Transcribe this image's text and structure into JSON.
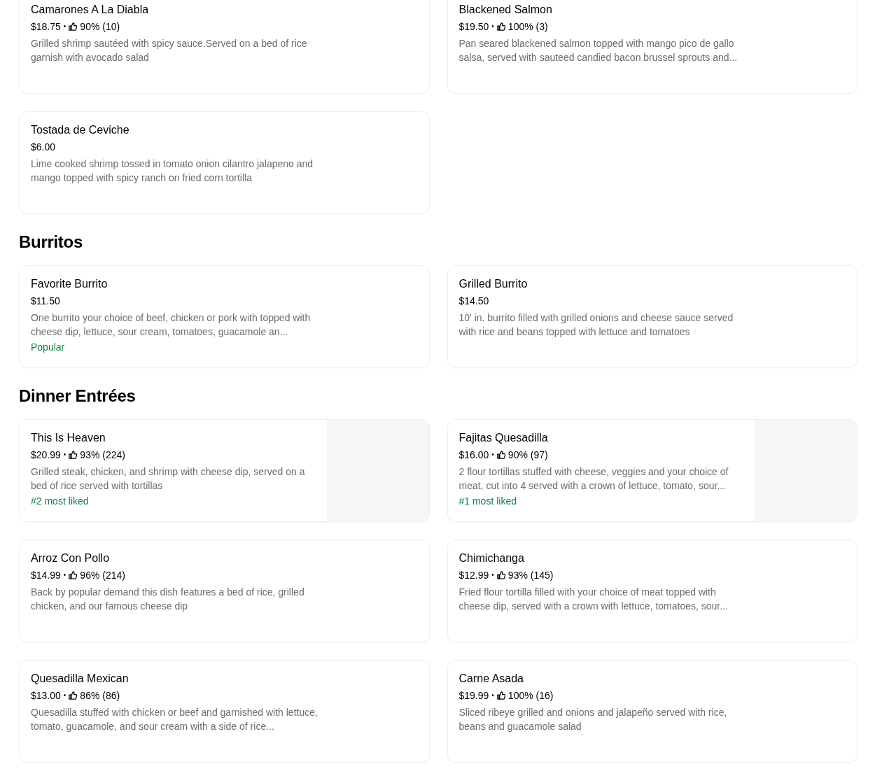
{
  "sections": [
    {
      "items": [
        {
          "kind": "plain",
          "name": "Camarones A La Diabla",
          "price": "$18.75",
          "separator": "•",
          "rating": "90% (10)",
          "description": "Grilled shrimp sautéed with spicy sauce.Served on a bed of rice garnish with avocado salad"
        },
        {
          "kind": "plain",
          "name": "Blackened Salmon",
          "price": "$19.50",
          "separator": "•",
          "rating": "100% (3)",
          "description": "Pan seared blackened salmon topped with mango pico de gallo salsa, served with sauteed candied bacon brussel sprouts and..."
        },
        {
          "kind": "plain",
          "name": "Tostada de Ceviche",
          "price": "$6.00",
          "description": "Lime cooked shrimp tossed in tomato onion cilantro jalapeno and mango topped with spicy ranch on fried corn tortilla"
        }
      ]
    },
    {
      "title": "Burritos",
      "items": [
        {
          "kind": "plain",
          "name": "Favorite Burrito",
          "price": "$11.50",
          "description": "One burrito your choice of beef, chicken or pork with topped with cheese dip, lettuce, sour cream, tomatoes, guacamole an...",
          "badge": "Popular"
        },
        {
          "kind": "plain",
          "name": "Grilled Burrito",
          "price": "$14.50",
          "description": "10' in. burrito filled with grilled onions and cheese sauce served with rice and beans topped with lettuce and tomatoes"
        }
      ]
    },
    {
      "title": "Dinner Entrées",
      "items": [
        {
          "kind": "with-image",
          "name": "This Is Heaven",
          "price": "$20.99",
          "separator": "•",
          "rating": "93% (224)",
          "description": "Grilled steak, chicken, and shrimp with cheese dip, served on a bed of rice served with tortillas",
          "badge": "#2 most liked"
        },
        {
          "kind": "with-image",
          "name": "Fajitas Quesadilla",
          "price": "$16.00",
          "separator": "•",
          "rating": "90% (97)",
          "description": "2 flour tortillas stuffed with cheese, veggies and your choice of meat, cut into 4 served with a crown of lettuce, tomato, sour...",
          "badge": "#1 most liked"
        },
        {
          "kind": "plain",
          "name": "Arroz Con Pollo",
          "price": "$14.99",
          "separator": "•",
          "rating": "96% (214)",
          "description": "Back by popular demand this dish features a bed of rice, grilled chicken, and our famous cheese dip"
        },
        {
          "kind": "plain",
          "name": "Chimichanga",
          "price": "$12.99",
          "separator": "•",
          "rating": "93% (145)",
          "description": "Fried flour tortilla filled with your choice of meat topped with cheese dip, served with a crown with lettuce, tomatoes, sour..."
        },
        {
          "kind": "plain",
          "name": "Quesadilla Mexican",
          "price": "$13.00",
          "separator": "•",
          "rating": "86% (86)",
          "description": "Quesadilla stuffed with chicken or beef and garnished with lettuce, tomato, guacamole, and sour cream with a side of rice..."
        },
        {
          "kind": "plain",
          "name": "Carne Asada",
          "price": "$19.99",
          "separator": "•",
          "rating": "100% (16)",
          "description": "Sliced ribeye grilled and onions and jalapeño served with rice, beans and guacamole salad"
        }
      ]
    }
  ]
}
